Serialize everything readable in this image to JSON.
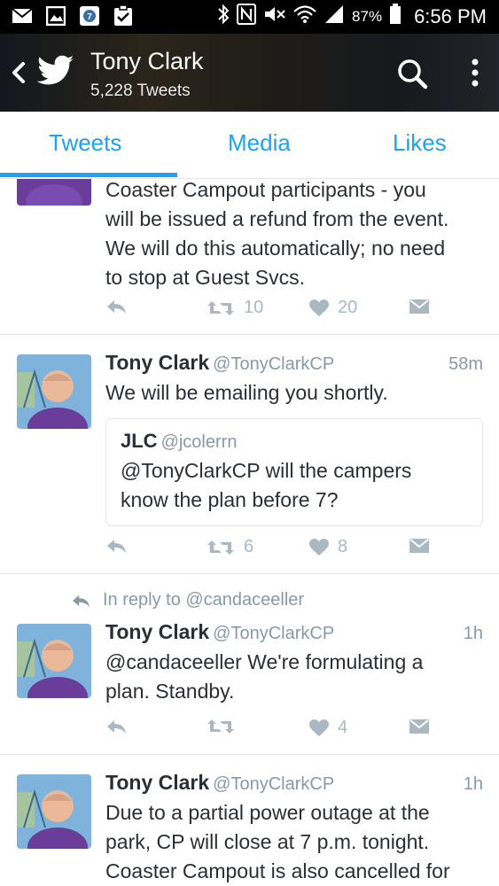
{
  "status_bar": {
    "battery_percent": "87%",
    "time": "6:56 PM"
  },
  "header": {
    "name": "Tony Clark",
    "tweet_count": "5,228 Tweets"
  },
  "tabs": [
    {
      "label": "Tweets",
      "active": true
    },
    {
      "label": "Media",
      "active": false
    },
    {
      "label": "Likes",
      "active": false
    }
  ],
  "tweets": [
    {
      "text_lines": [
        "Coaster Campout participants - you",
        "will be issued a refund from the event.",
        "We will do this automatically; no need",
        "to stop at Guest Svcs."
      ],
      "retweets": "10",
      "likes": "20"
    },
    {
      "name": "Tony Clark",
      "handle": "@TonyClarkCP",
      "time": "58m",
      "text": "We will be emailing you shortly.",
      "quote": {
        "name": "JLC",
        "handle": "@jcolerrn",
        "text_lines": [
          "@TonyClarkCP will the campers",
          "know the plan before 7?"
        ]
      },
      "retweets": "6",
      "likes": "8"
    },
    {
      "in_reply_to": "In reply to @candaceeller",
      "name": "Tony Clark",
      "handle": "@TonyClarkCP",
      "time": "1h",
      "text_lines": [
        "@candaceeller We're formulating a",
        "plan. Standby."
      ],
      "retweets": "",
      "likes": "4"
    },
    {
      "name": "Tony Clark",
      "handle": "@TonyClarkCP",
      "time": "1h",
      "text_lines": [
        "Due to a partial power outage at the",
        "park, CP will close at 7 p.m. tonight.",
        "Coaster Campout is also cancelled for"
      ]
    }
  ],
  "colors": {
    "accent": "#1da1f2",
    "action_gray": "#aab8c2",
    "meta_gray": "#8899a6",
    "text": "#292f33"
  }
}
